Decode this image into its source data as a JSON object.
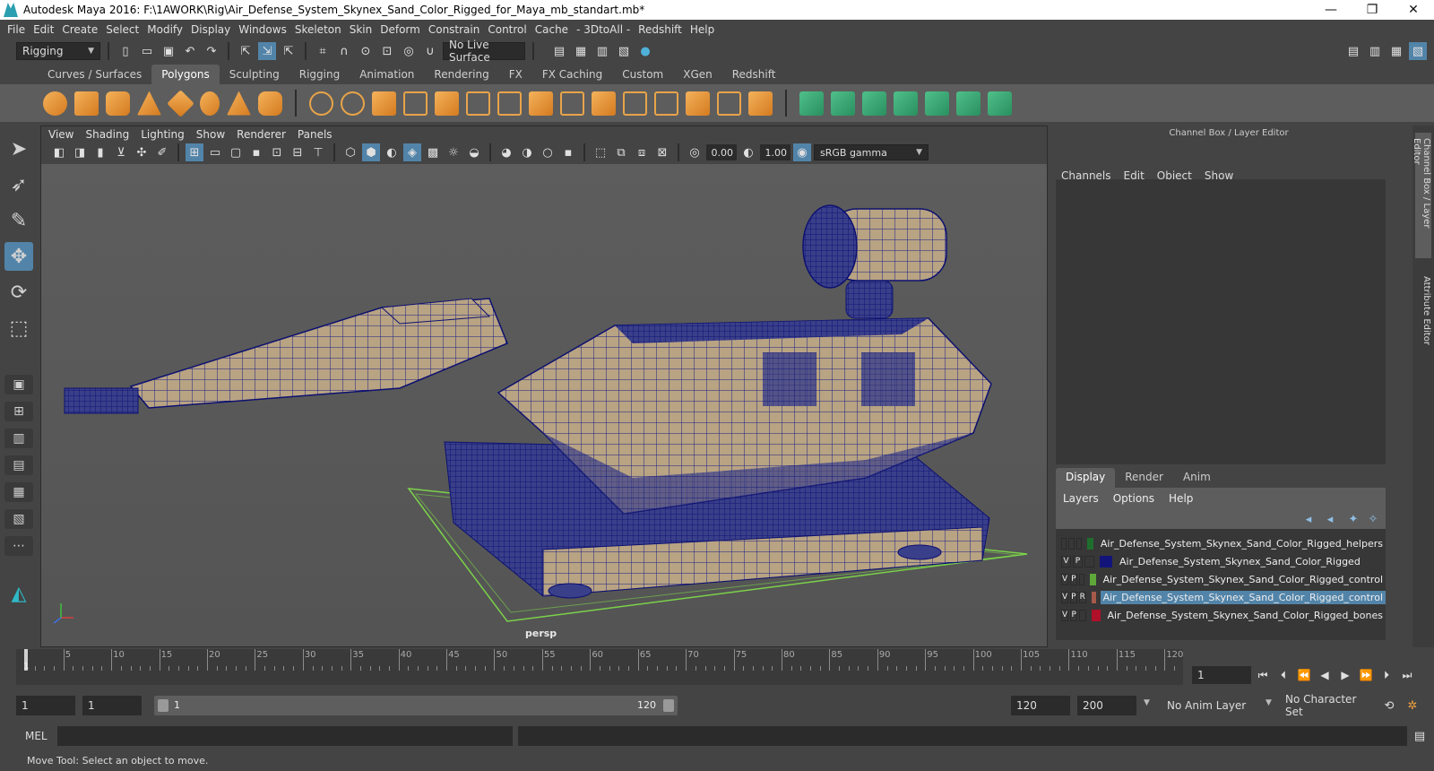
{
  "window": {
    "title": "Autodesk Maya 2016: F:\\1AWORK\\Rig\\Air_Defense_System_Skynex_Sand_Color_Rigged_for_Maya_mb_standart.mb*",
    "minimize": "—",
    "maximize": "❐",
    "close": "✕"
  },
  "menus": [
    "File",
    "Edit",
    "Create",
    "Select",
    "Modify",
    "Display",
    "Windows",
    "Skeleton",
    "Skin",
    "Deform",
    "Constrain",
    "Control",
    "Cache",
    "- 3DtoAll -",
    "Redshift",
    "Help"
  ],
  "status_line": {
    "mode": "Rigging",
    "live_surface": "No Live Surface"
  },
  "shelf": {
    "tabs": [
      "Curves / Surfaces",
      "Polygons",
      "Sculpting",
      "Rigging",
      "Animation",
      "Rendering",
      "FX",
      "FX Caching",
      "Custom",
      "XGen",
      "Redshift"
    ],
    "active_tab": "Polygons"
  },
  "panel": {
    "menus": [
      "View",
      "Shading",
      "Lighting",
      "Show",
      "Renderer",
      "Panels"
    ],
    "exposure": "0.00",
    "gamma": "1.00",
    "color_space": "sRGB gamma",
    "camera": "persp"
  },
  "channel_box": {
    "title": "Channel Box / Layer Editor",
    "menus": [
      "Channels",
      "Edit",
      "Object",
      "Show"
    ],
    "layer_tabs": [
      "Display",
      "Render",
      "Anim"
    ],
    "active_layer_tab": "Display",
    "layer_menus": [
      "Layers",
      "Options",
      "Help"
    ],
    "layers": [
      {
        "v": "",
        "p": "",
        "r": "",
        "color": "#1f6e2d",
        "name": "Air_Defense_System_Skynex_Sand_Color_Rigged_helpers",
        "selected": false
      },
      {
        "v": "V",
        "p": "P",
        "r": "",
        "color": "#12147a",
        "name": "Air_Defense_System_Skynex_Sand_Color_Rigged",
        "selected": false
      },
      {
        "v": "V",
        "p": "P",
        "r": "",
        "color": "#5ea83a",
        "name": "Air_Defense_System_Skynex_Sand_Color_Rigged_control",
        "selected": false
      },
      {
        "v": "V",
        "p": "P",
        "r": "R",
        "color": "#a65a4a",
        "name": "Air_Defense_System_Skynex_Sand_Color_Rigged_control",
        "selected": true
      },
      {
        "v": "V",
        "p": "P",
        "r": "",
        "color": "#b0102a",
        "name": "Air_Defense_System_Skynex_Sand_Color_Rigged_bones",
        "selected": false
      }
    ],
    "side_tabs": [
      "Channel Box / Layer Editor",
      "Attribute Editor"
    ]
  },
  "timeline": {
    "ticks": [
      5,
      10,
      15,
      20,
      25,
      30,
      35,
      40,
      45,
      50,
      55,
      60,
      65,
      70,
      75,
      80,
      85,
      90,
      95,
      100,
      105,
      110,
      115,
      120
    ],
    "current_frame": "1",
    "range_start": "1",
    "range_inner_start": "1",
    "range_inner_start_label": "1",
    "range_inner_end_label": "120",
    "range_end": "120",
    "anim_end": "200",
    "anim_layer": "No Anim Layer",
    "character_set": "No Character Set",
    "playhead_frame": "1"
  },
  "command_line": {
    "label": "MEL",
    "help": "Move Tool: Select an object to move."
  }
}
